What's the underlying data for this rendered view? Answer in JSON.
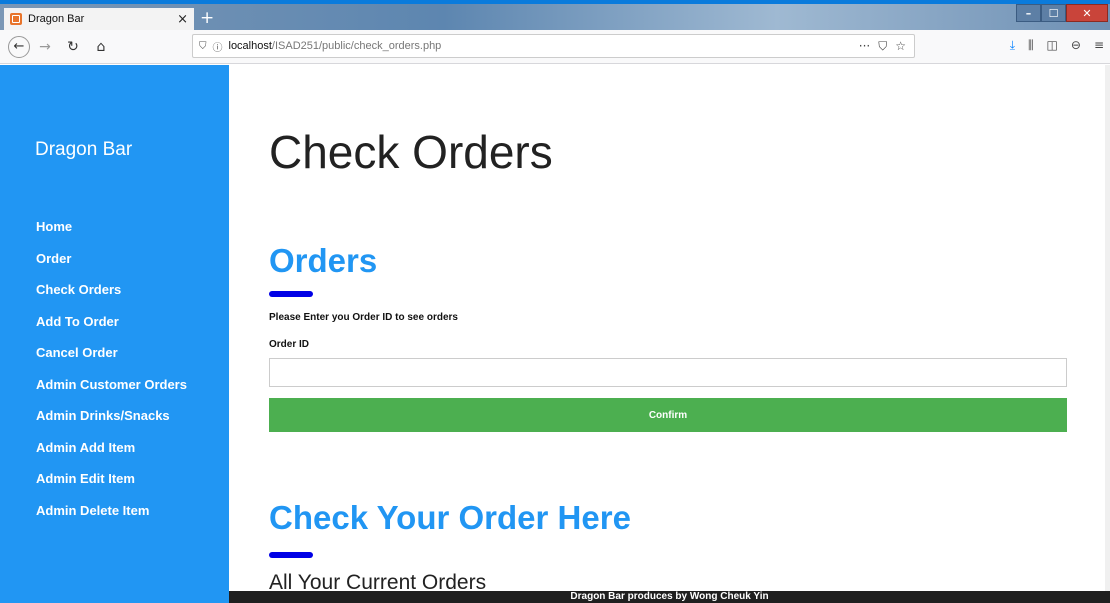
{
  "browser": {
    "tab_title": "Dragon Bar",
    "tab_close": "×",
    "new_tab": "+",
    "url_host": "localhost",
    "url_path": "/ISAD251/public/check_orders.php",
    "url_menu": "···"
  },
  "sidebar": {
    "brand": "Dragon Bar",
    "items": [
      {
        "label": "Home"
      },
      {
        "label": "Order"
      },
      {
        "label": "Check Orders"
      },
      {
        "label": "Add To Order"
      },
      {
        "label": "Cancel Order"
      },
      {
        "label": "Admin Customer Orders"
      },
      {
        "label": "Admin Drinks/Snacks"
      },
      {
        "label": "Admin Add Item"
      },
      {
        "label": "Admin Edit Item"
      },
      {
        "label": "Admin Delete Item"
      }
    ]
  },
  "main": {
    "page_title": "Check Orders",
    "orders_heading": "Orders",
    "instruction": "Please Enter you Order ID to see orders",
    "order_id_label": "Order ID",
    "order_id_value": "",
    "confirm_label": "Confirm",
    "check_heading": "Check Your Order Here",
    "current_orders": "All Your Current Orders"
  },
  "footer": {
    "text": "Dragon Bar produces by Wong Cheuk Yin"
  },
  "colors": {
    "sidebar": "#2196f3",
    "accent_bar": "#0000e6",
    "confirm_button": "#4caf50",
    "footer": "#1f1f1f"
  }
}
